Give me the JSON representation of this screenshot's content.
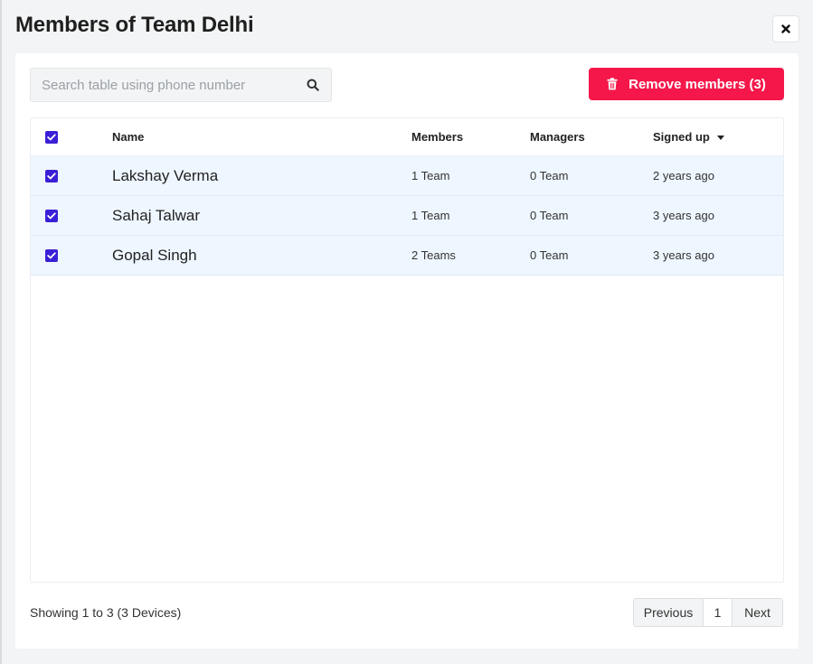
{
  "modal": {
    "title": "Members of Team Delhi"
  },
  "search": {
    "placeholder": "Search table using phone number",
    "value": ""
  },
  "actions": {
    "remove_label": "Remove members (3)",
    "remove_color": "#f5174a"
  },
  "table": {
    "columns": {
      "name": "Name",
      "members": "Members",
      "managers": "Managers",
      "signed_up": "Signed up"
    },
    "sort": {
      "column": "signed_up",
      "direction": "descending"
    },
    "select_all_checked": true,
    "rows": [
      {
        "name": "Lakshay Verma",
        "members": "1 Team",
        "managers": "0 Team",
        "signed_up": "2 years ago",
        "checked": true
      },
      {
        "name": "Sahaj Talwar",
        "members": "1 Team",
        "managers": "0 Team",
        "signed_up": "3 years ago",
        "checked": true
      },
      {
        "name": "Gopal Singh",
        "members": "2 Teams",
        "managers": "0 Team",
        "signed_up": "3 years ago",
        "checked": true
      }
    ]
  },
  "footer": {
    "showing": "Showing 1 to 3 (3 Devices)"
  },
  "pagination": {
    "previous": "Previous",
    "current_page": "1",
    "next": "Next"
  },
  "colors": {
    "checkbox": "#3b1fd6",
    "selected_row": "#eef6ff",
    "background": "#f3f4f5"
  },
  "icons": {
    "close": "close-icon",
    "search": "search-icon",
    "trash": "trash-icon",
    "sort": "sort-down-icon",
    "check": "check-icon"
  }
}
